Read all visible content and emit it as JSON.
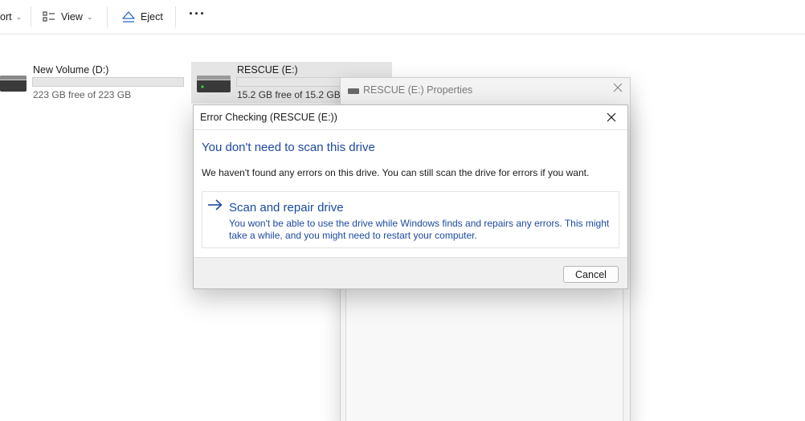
{
  "toolbar": {
    "sort_label": "ort",
    "view_label": "View",
    "eject_label": "Eject",
    "more_label": "···"
  },
  "drives": [
    {
      "name": "New Volume (D:)",
      "free_text": "223 GB free of 223 GB",
      "used_fraction": 0.0
    },
    {
      "name": "RESCUE (E:)",
      "free_text": "15.2 GB free of 15.2 GB",
      "used_fraction": 0.0,
      "selected": true
    }
  ],
  "properties_window": {
    "title": "RESCUE (E:) Properties"
  },
  "error_dialog": {
    "title": "Error Checking (RESCUE (E:))",
    "heading": "You don't need to scan this drive",
    "message": "We haven't found any errors on this drive. You can still scan the drive for errors if you want.",
    "scan_option": {
      "label": "Scan and repair drive",
      "description": "You won't be able to use the drive while Windows finds and repairs any errors. This might take a while, and you might need to restart your computer."
    },
    "cancel_label": "Cancel"
  },
  "colors": {
    "accent_link": "#1c4aa0",
    "selection": "#e5e5e5"
  },
  "icons": {
    "view": "layout-list-icon",
    "eject": "eject-icon",
    "drive": "hard-drive-icon",
    "close": "close-icon",
    "arrow": "arrow-right-icon"
  }
}
